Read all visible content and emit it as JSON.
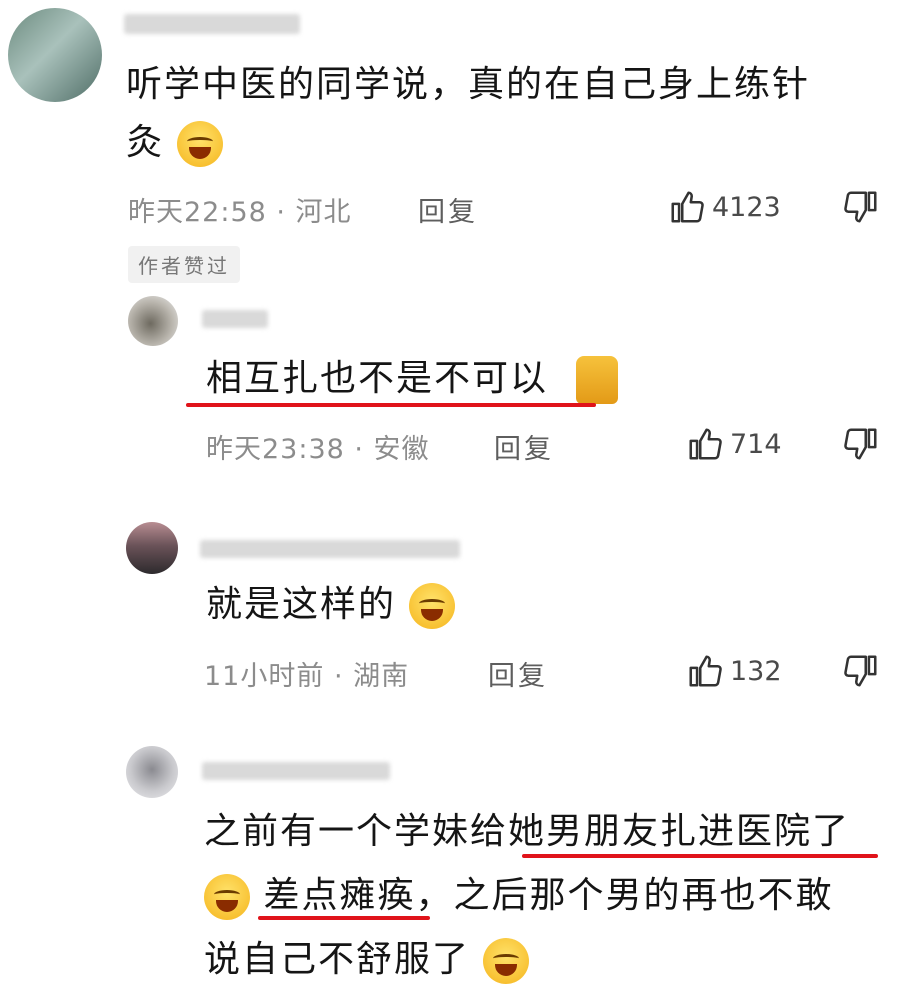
{
  "comments": [
    {
      "text_line1": "听学中医的同学说，真的在自己身上练针",
      "text_line2": "灸",
      "time_location": "昨天22:58 · 河北",
      "reply_label": "回复",
      "likes": "4123",
      "badge": "作者赞过"
    },
    {
      "text": "相互扎也不是不可以",
      "time_location": "昨天23:38 · 安徽",
      "reply_label": "回复",
      "likes": "714"
    },
    {
      "text": "就是这样的",
      "time_location": "11小时前 · 湖南",
      "reply_label": "回复",
      "likes": "132"
    },
    {
      "text_line1": "之前有一个学妹给她男朋友扎进医院了",
      "text_line2": "差点瘫痪，之后那个男的再也不敢",
      "text_line3": "说自己不舒服了"
    }
  ],
  "icons": {
    "like": "thumbs-up-icon",
    "dislike": "thumbs-down-icon",
    "emoji": "laughing-crying-emoji-icon",
    "cat": "cat-emoji-icon"
  },
  "colors": {
    "annotation_underline": "#e0131a"
  }
}
